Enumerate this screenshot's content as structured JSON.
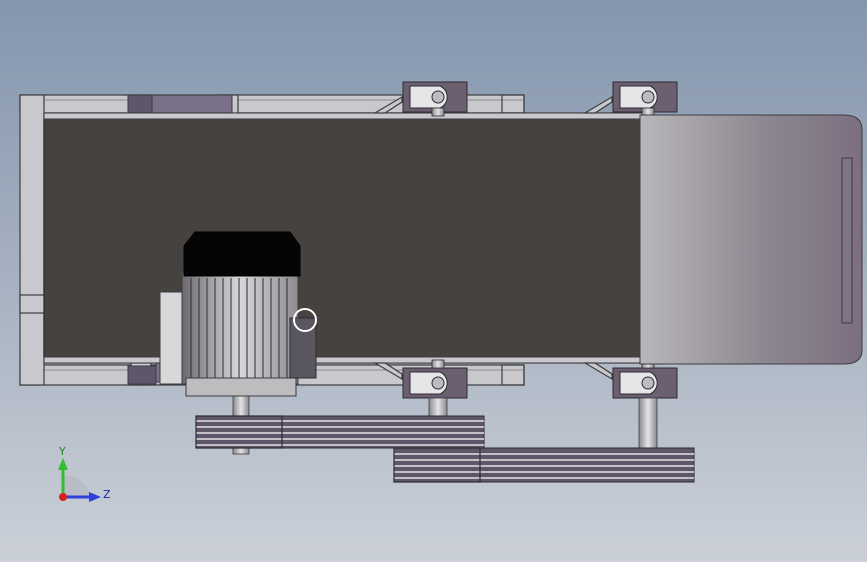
{
  "viewport": {
    "background_top": "#8496ae",
    "background_bottom": "#cbd0d8"
  },
  "model": {
    "frame_color": "#c8c8cc",
    "frame_edge_color": "#3c3c40",
    "belt_color": "#46423f",
    "bracket_color": "#6a6070",
    "end_roller_color_light": "#b9b7ba",
    "end_roller_color_dark": "#7c6f80",
    "motor_cap_color": "#050505",
    "pulley_color": "#60566a"
  },
  "triad": {
    "y_label": "Y",
    "z_label": "Z",
    "y_color": "#2fbf2f",
    "z_color": "#2f3fd8",
    "x_color": "#d82020",
    "icons": [
      "y-axis-arrow",
      "z-axis-arrow",
      "origin-dot"
    ]
  }
}
